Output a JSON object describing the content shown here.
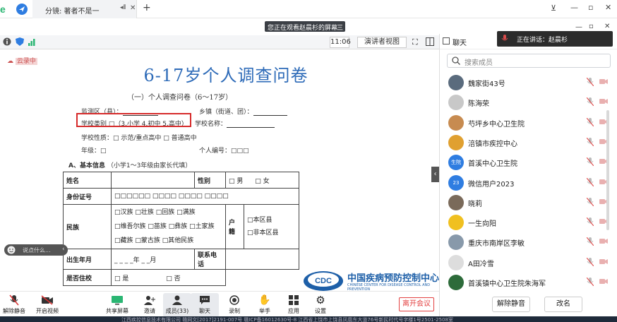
{
  "browser": {
    "tab_title": "分镜: 著者不是一",
    "new_tab": "+"
  },
  "share_banner": {
    "text": "您正在观看赵晨杉的屏幕",
    "icon": "三"
  },
  "toolbar": {
    "time": "11:06",
    "view_mode": "演讲者视图"
  },
  "doc": {
    "cloud_label": "云录中",
    "title": "6-17岁个人调查问卷",
    "subtitle": "（一）个人调查问卷（6～17岁）",
    "line_district": "监测区（县）：",
    "line_town": "乡镇（街道、团）：",
    "line_school_type": "学校类别 □（3.小学 4.初中 5.高中）",
    "line_school_name": "学校名称：",
    "line_school_nature": "学校性质：□ 示范/重点高中   □ 普通高中",
    "line_grade": "年级：□",
    "line_id": "个人编号：□□□",
    "section_a": "A、基本信息",
    "section_a_note": "（小学1～3年级由家长代填）",
    "row_name": "姓名",
    "row_gender": "性别",
    "gender_male": "□ 男",
    "gender_female": "□ 女",
    "row_idcard": "身份证号",
    "idcard_boxes": "□□□□□□ □□□□ □□□□ □□□□",
    "row_ethnic": "民族",
    "ethnic_1": "□汉族      □壮族      □回族      □满族",
    "ethnic_2": "□维吾尔族  □苗族  □彝族  □土家族",
    "ethnic_3": "□藏族      □蒙古族  □其他民族",
    "row_hukou": "户籍",
    "hukou_1": "□本区县",
    "hukou_2": "□非本区县",
    "row_birth": "出生年月",
    "birth_value": "_ _ _ _年 _ _月",
    "row_phone": "联系电话",
    "row_school": "是否住校",
    "school_yes": "□ 是",
    "school_no": "□ 否",
    "cdc_logo": "CDC",
    "cdc_name": "中国疾病预防控制中心",
    "cdc_en": "CHINESE CENTER FOR DISEASE CONTROL AND PREVENTION"
  },
  "chat_input": {
    "placeholder": "说点什么..."
  },
  "panel": {
    "title": "聊天",
    "search_placeholder": "搜索成员",
    "members": [
      {
        "name": "魏家街43号",
        "color": "#5a6b7d",
        "avatar_text": ""
      },
      {
        "name": "陈海荣",
        "color": "#c8c8c8",
        "avatar_text": ""
      },
      {
        "name": "芍坪乡中心卫生院",
        "color": "#c78b50",
        "avatar_text": ""
      },
      {
        "name": "涪镇市疾控中心",
        "color": "#e0a030",
        "avatar_text": ""
      },
      {
        "name": "首溪中心卫生院",
        "color": "#2f7de1",
        "avatar_text": "生院"
      },
      {
        "name": "微信用户2023",
        "color": "#2f7de1",
        "avatar_text": "23"
      },
      {
        "name": "晓莉",
        "color": "#7a6a5a",
        "avatar_text": ""
      },
      {
        "name": "一生向阳",
        "color": "#f0c020",
        "avatar_text": ""
      },
      {
        "name": "重庆市南岸区李敏",
        "color": "#8899aa",
        "avatar_text": ""
      },
      {
        "name": "A田冷雪",
        "color": "#dddddd",
        "avatar_text": ""
      },
      {
        "name": "首溪镇中心卫生院朱海军",
        "color": "#2d6b3a",
        "avatar_text": ""
      }
    ],
    "mute_all": "解除静音",
    "rename": "改名"
  },
  "speaking": {
    "label": "正在讲话：赵晨杉"
  },
  "bottombar": {
    "mute": "解除静音",
    "video": "开启视频",
    "share": "共享屏幕",
    "invite": "邀请",
    "members": "成员(33)",
    "chat": "聊天",
    "record": "录制",
    "raise": "举手",
    "apps": "应用",
    "settings": "设置",
    "leave": "离开会议"
  },
  "taskbar": {
    "text": "江西疾控信息技术有限公司  赣网文[2017]2191-007号  赣ICP备16012630号-8  江西省上饶市上饶县凤凰东大道76号新民时代号字楼1号2501-2508室"
  }
}
